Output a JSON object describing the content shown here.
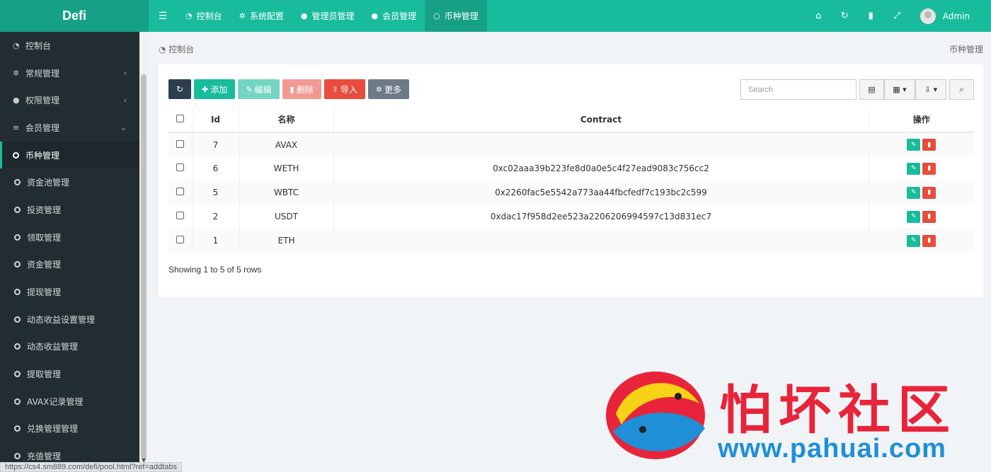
{
  "app": {
    "logo": "Defi"
  },
  "topnav": {
    "tabs": [
      {
        "label": "控制台",
        "icon": "dashboard-icon"
      },
      {
        "label": "系统配置",
        "icon": "gears-icon"
      },
      {
        "label": "管理员管理",
        "icon": "user-icon"
      },
      {
        "label": "会员管理",
        "icon": "user-icon"
      },
      {
        "label": "币种管理",
        "icon": "circle-icon"
      }
    ],
    "user": "Admin"
  },
  "sidebar": {
    "items": [
      {
        "label": "控制台"
      },
      {
        "label": "常规管理"
      },
      {
        "label": "权限管理"
      },
      {
        "label": "会员管理"
      },
      {
        "label": "币种管理"
      },
      {
        "label": "资金池管理"
      },
      {
        "label": "投资管理"
      },
      {
        "label": "领取管理"
      },
      {
        "label": "资金管理"
      },
      {
        "label": "提现管理"
      },
      {
        "label": "动态收益设置管理"
      },
      {
        "label": "动态收益管理"
      },
      {
        "label": "提取管理"
      },
      {
        "label": "AVAX记录管理"
      },
      {
        "label": "兑换管理管理"
      },
      {
        "label": "充值管理"
      }
    ]
  },
  "breadcrumb": {
    "left": "控制台",
    "right": "币种管理"
  },
  "toolbar": {
    "add": "添加",
    "edit": "编辑",
    "delete": "删除",
    "import": "导入",
    "more": "更多",
    "search_placeholder": "Search"
  },
  "table": {
    "headers": {
      "id": "Id",
      "name": "名称",
      "contract": "Contract",
      "ops": "操作"
    },
    "rows": [
      {
        "id": "7",
        "name": "AVAX",
        "contract": ""
      },
      {
        "id": "6",
        "name": "WETH",
        "contract": "0xc02aaa39b223fe8d0a0e5c4f27ead9083c756cc2"
      },
      {
        "id": "5",
        "name": "WBTC",
        "contract": "0x2260fac5e5542a773aa44fbcfedf7c193bc2c599"
      },
      {
        "id": "2",
        "name": "USDT",
        "contract": "0xdac17f958d2ee523a2206206994597c13d831ec7"
      },
      {
        "id": "1",
        "name": "ETH",
        "contract": ""
      }
    ],
    "summary": "Showing 1 to 5 of 5 rows"
  },
  "status": {
    "url": "https://cs4.sm889.com/defi/pool.html?ref=addtabs"
  },
  "watermark": {
    "title": "怕坏社区",
    "url": "www.pahuai.com"
  },
  "colors": {
    "primary": "#18bc9c",
    "primary_dark": "#16a085",
    "sidebar": "#222d32",
    "danger": "#e74c3c"
  }
}
